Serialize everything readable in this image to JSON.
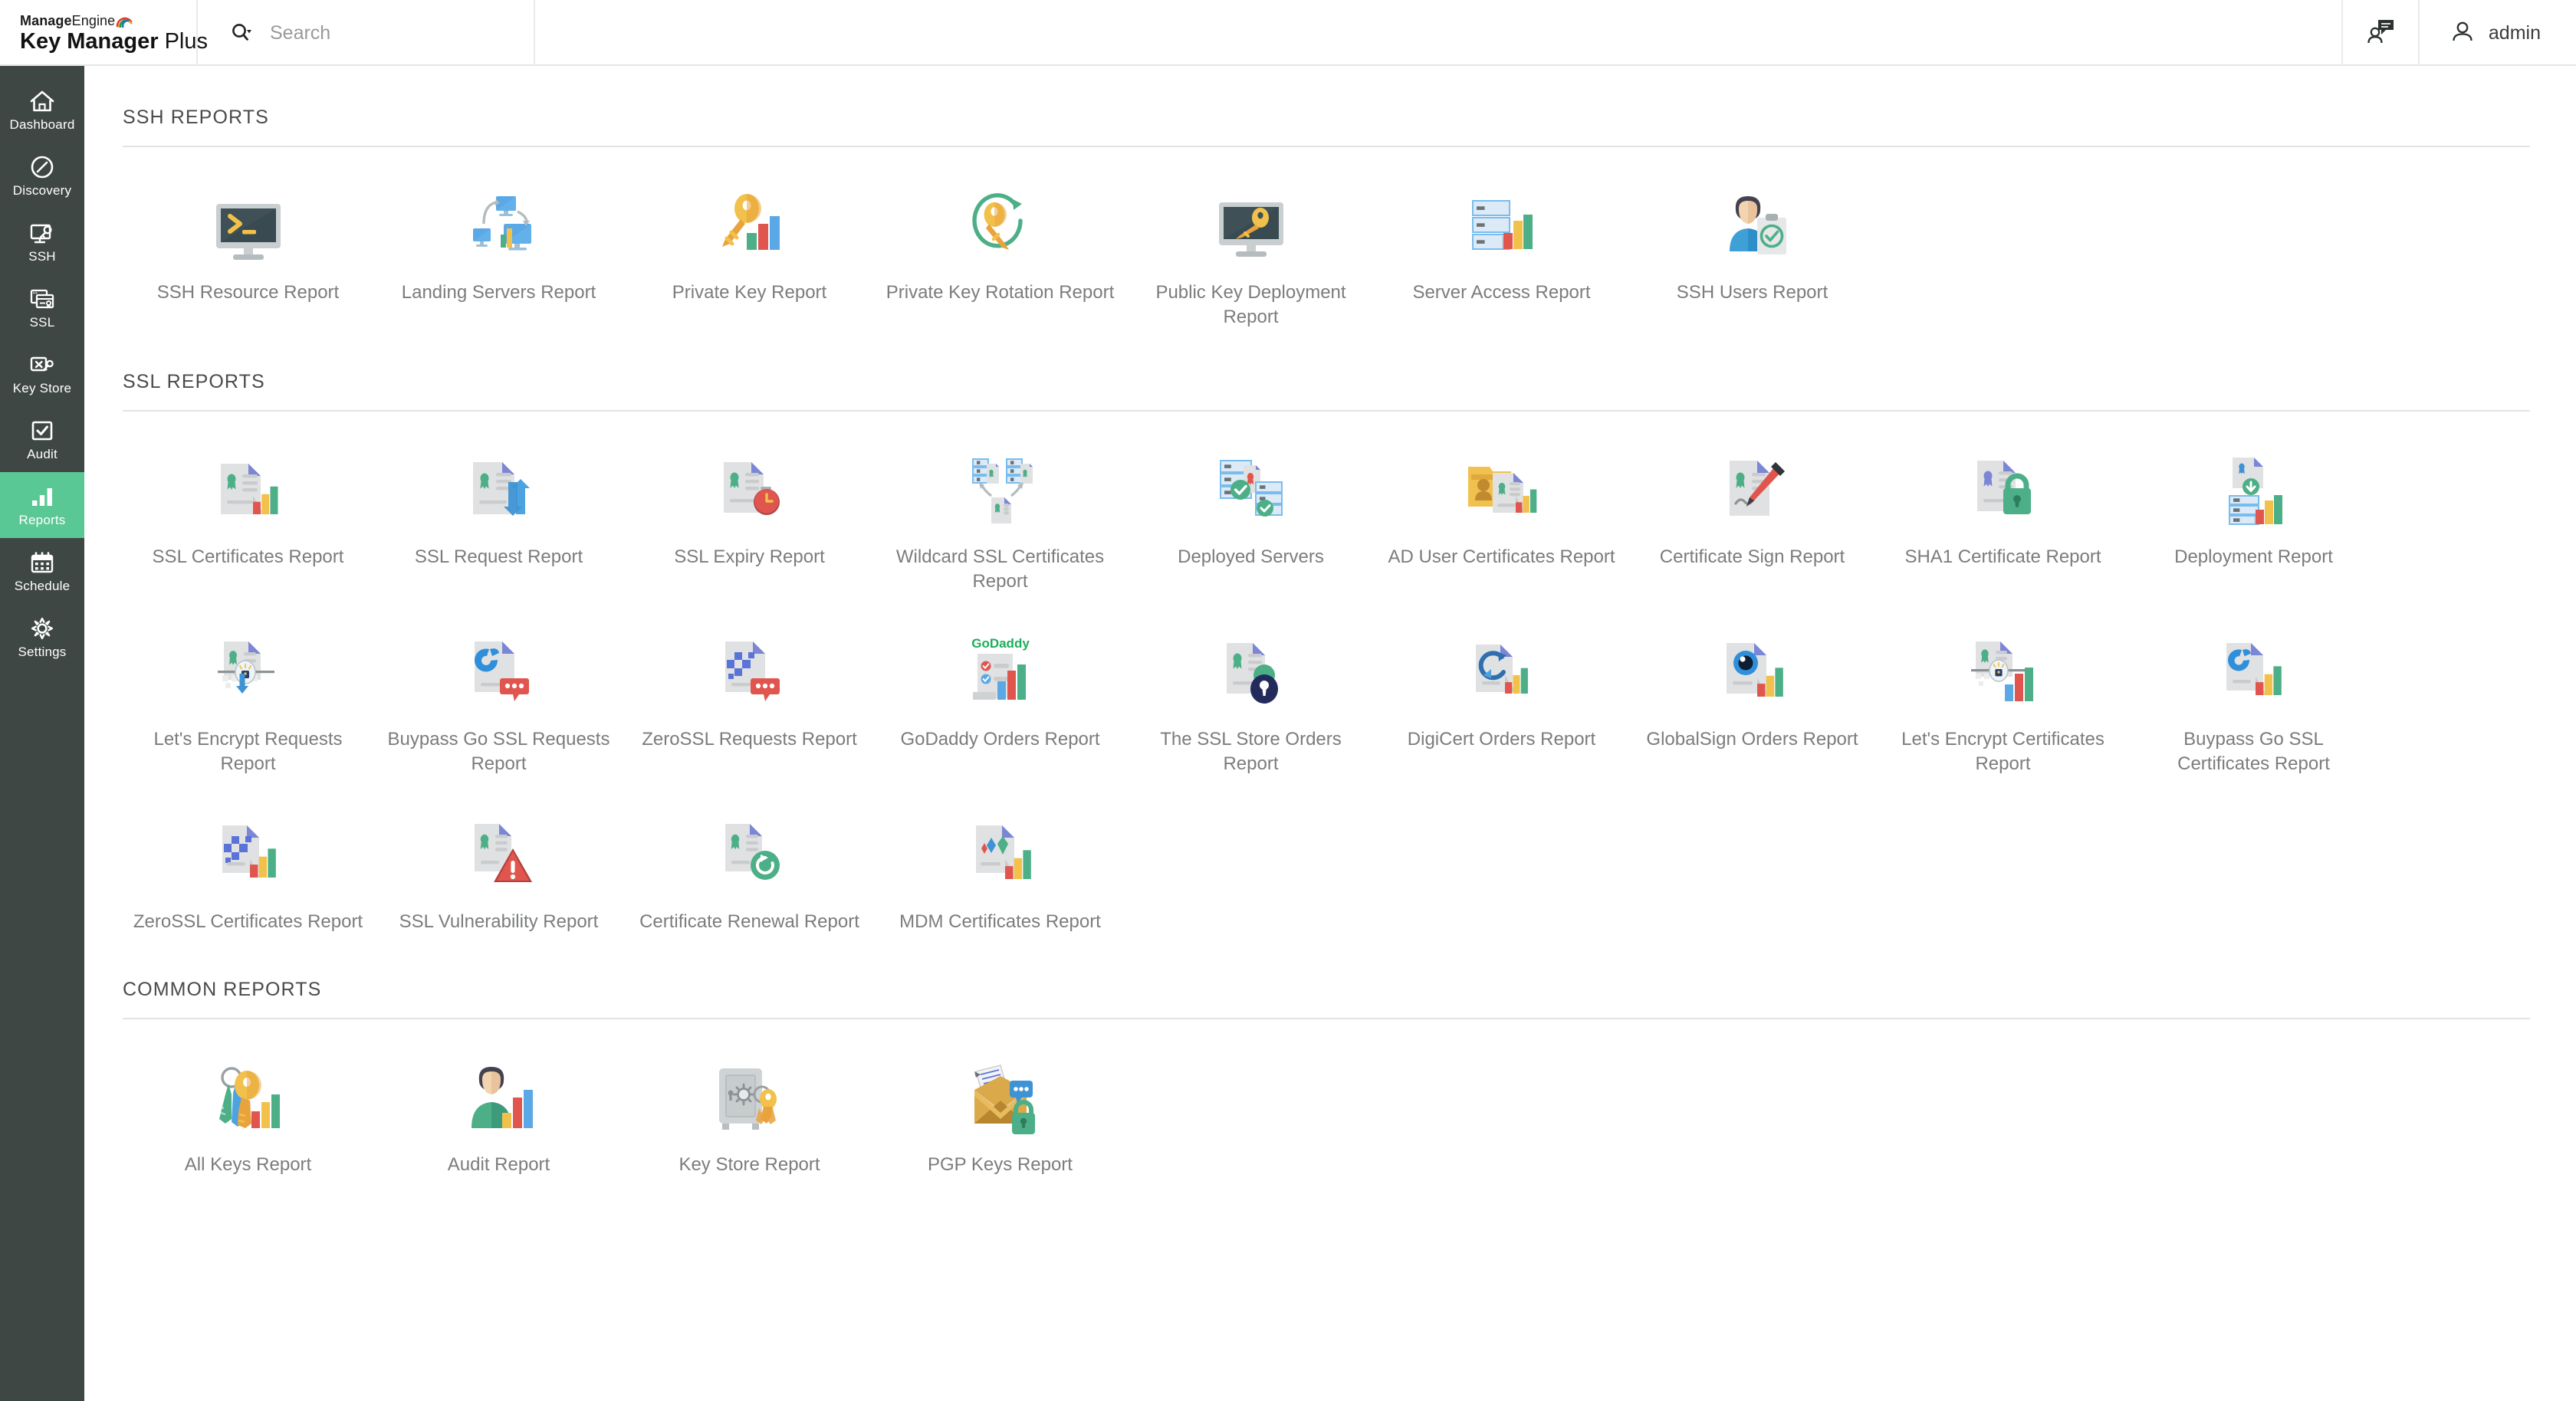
{
  "header": {
    "logo_brand_bold": "Manage",
    "logo_brand_light": "Engine",
    "logo_product_bold": "Key Manager",
    "logo_product_light": " Plus",
    "search_placeholder": "Search",
    "search_value": "",
    "search_icon": "search-icon",
    "support_icon": "user-chat-icon",
    "user_icon": "user-avatar-icon",
    "username": "admin"
  },
  "sidebar": {
    "active_color": "#5ac894",
    "background_color": "#3f4745",
    "items": [
      {
        "label": "Dashboard",
        "icon": "home-icon",
        "active": false
      },
      {
        "label": "Discovery",
        "icon": "compass-icon",
        "active": false
      },
      {
        "label": "SSH",
        "icon": "monitor-key-icon",
        "active": false
      },
      {
        "label": "SSL",
        "icon": "certificate-window-icon",
        "active": false
      },
      {
        "label": "Key Store",
        "icon": "keystore-icon",
        "active": false
      },
      {
        "label": "Audit",
        "icon": "checkbox-icon",
        "active": false
      },
      {
        "label": "Reports",
        "icon": "bar-chart-icon",
        "active": true
      },
      {
        "label": "Schedule",
        "icon": "calendar-icon",
        "active": false
      },
      {
        "label": "Settings",
        "icon": "gear-icon",
        "active": false
      }
    ]
  },
  "sections": [
    {
      "id": "ssh",
      "title": "SSH REPORTS",
      "cards": [
        {
          "label": "SSH Resource Report",
          "icon": "terminal-monitor-icon"
        },
        {
          "label": "Landing Servers Report",
          "icon": "landing-servers-icon"
        },
        {
          "label": "Private Key Report",
          "icon": "key-chart-icon"
        },
        {
          "label": "Private Key Rotation Report",
          "icon": "key-rotation-icon"
        },
        {
          "label": "Public Key Deployment Report",
          "icon": "monitor-key-deploy-icon"
        },
        {
          "label": "Server Access Report",
          "icon": "server-chart-icon"
        },
        {
          "label": "SSH Users Report",
          "icon": "user-clipboard-check-icon"
        }
      ]
    },
    {
      "id": "ssl",
      "title": "SSL REPORTS",
      "cards": [
        {
          "label": "SSL Certificates Report",
          "icon": "cert-chart-icon"
        },
        {
          "label": "SSL Request Report",
          "icon": "cert-arrows-icon"
        },
        {
          "label": "SSL Expiry Report",
          "icon": "cert-clock-icon"
        },
        {
          "label": "Wildcard SSL Certificates Report",
          "icon": "wildcard-cert-icon"
        },
        {
          "label": "Deployed Servers",
          "icon": "deployed-servers-icon"
        },
        {
          "label": "AD User Certificates Report",
          "icon": "ad-user-cert-icon"
        },
        {
          "label": "Certificate Sign Report",
          "icon": "cert-sign-icon"
        },
        {
          "label": "SHA1 Certificate Report",
          "icon": "cert-lock-icon"
        },
        {
          "label": "Deployment Report",
          "icon": "cert-download-server-icon"
        },
        {
          "label": "Let's Encrypt Requests Report",
          "icon": "letsencrypt-request-icon"
        },
        {
          "label": "Buypass Go SSL Requests Report",
          "icon": "buypass-request-icon"
        },
        {
          "label": "ZeroSSL Requests Report",
          "icon": "zerossl-request-icon"
        },
        {
          "label": "GoDaddy Orders Report",
          "icon": "godaddy-orders-icon"
        },
        {
          "label": "The SSL Store Orders Report",
          "icon": "sslstore-orders-icon"
        },
        {
          "label": "DigiCert Orders Report",
          "icon": "digicert-orders-icon"
        },
        {
          "label": "GlobalSign Orders Report",
          "icon": "globalsign-orders-icon"
        },
        {
          "label": "Let's Encrypt Certificates Report",
          "icon": "letsencrypt-cert-icon"
        },
        {
          "label": "Buypass Go SSL Certificates Report",
          "icon": "buypass-cert-icon"
        },
        {
          "label": "ZeroSSL Certificates Report",
          "icon": "zerossl-cert-icon"
        },
        {
          "label": "SSL Vulnerability Report",
          "icon": "cert-warning-icon"
        },
        {
          "label": "Certificate Renewal Report",
          "icon": "cert-renew-icon"
        },
        {
          "label": "MDM Certificates Report",
          "icon": "mdm-cert-icon"
        }
      ]
    },
    {
      "id": "common",
      "title": "COMMON REPORTS",
      "cards": [
        {
          "label": "All Keys Report",
          "icon": "keyring-chart-icon"
        },
        {
          "label": "Audit Report",
          "icon": "user-chart-icon"
        },
        {
          "label": "Key Store Report",
          "icon": "safe-keys-icon"
        },
        {
          "label": "PGP Keys Report",
          "icon": "envelope-lock-icon"
        }
      ]
    }
  ],
  "colors": {
    "accent_green": "#5ac894",
    "sidebar_bg": "#3f4745",
    "doc_gray": "#e0e1e2",
    "ribbon_green": "#4caf87",
    "ribbon_blue": "#7b86d6",
    "bar_red": "#e0564f",
    "bar_yellow": "#f2c14b",
    "bar_blue": "#5aa9e6",
    "bar_green": "#4caf87",
    "godaddy_green": "#1bae5a",
    "text_gray": "#7b7c7d"
  }
}
